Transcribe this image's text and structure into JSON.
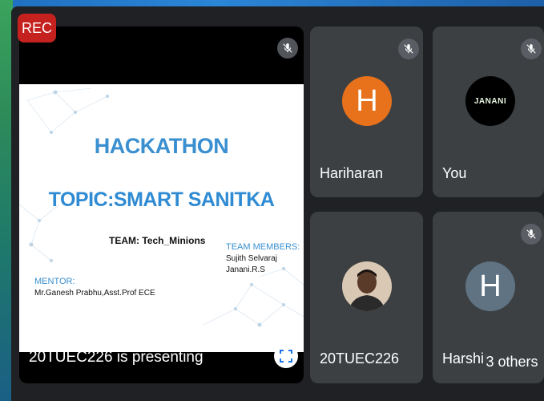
{
  "rec_label": "REC",
  "presentation": {
    "caption": "20TUEC226 is presenting",
    "slide": {
      "title": "HACKATHON",
      "topic": "TOPIC:SMART SANITKA",
      "team": "TEAM: Tech_Minions",
      "members_heading": "TEAM MEMBERS:",
      "members": [
        "Sujith Selvaraj",
        "Janani.R.S"
      ],
      "mentor_heading": "MENTOR:",
      "mentor": "Mr.Ganesh Prabhu,Asst.Prof ECE"
    }
  },
  "participants": [
    {
      "name": "Hariharan",
      "initial": "H",
      "avatar_color": "#e8711c"
    },
    {
      "name": "You",
      "avatar_text": "JANANI",
      "avatar_color": "#000000"
    },
    {
      "name": "20TUEC226"
    },
    {
      "name": "Harshit",
      "initial": "H",
      "avatar_color": "#5f7383"
    }
  ],
  "others_label": "3 others",
  "colors": {
    "accent_blue": "#3a8fd0",
    "rec_red": "#c5221f",
    "tile_bg": "#3c4043",
    "stage_bg": "#202124"
  }
}
